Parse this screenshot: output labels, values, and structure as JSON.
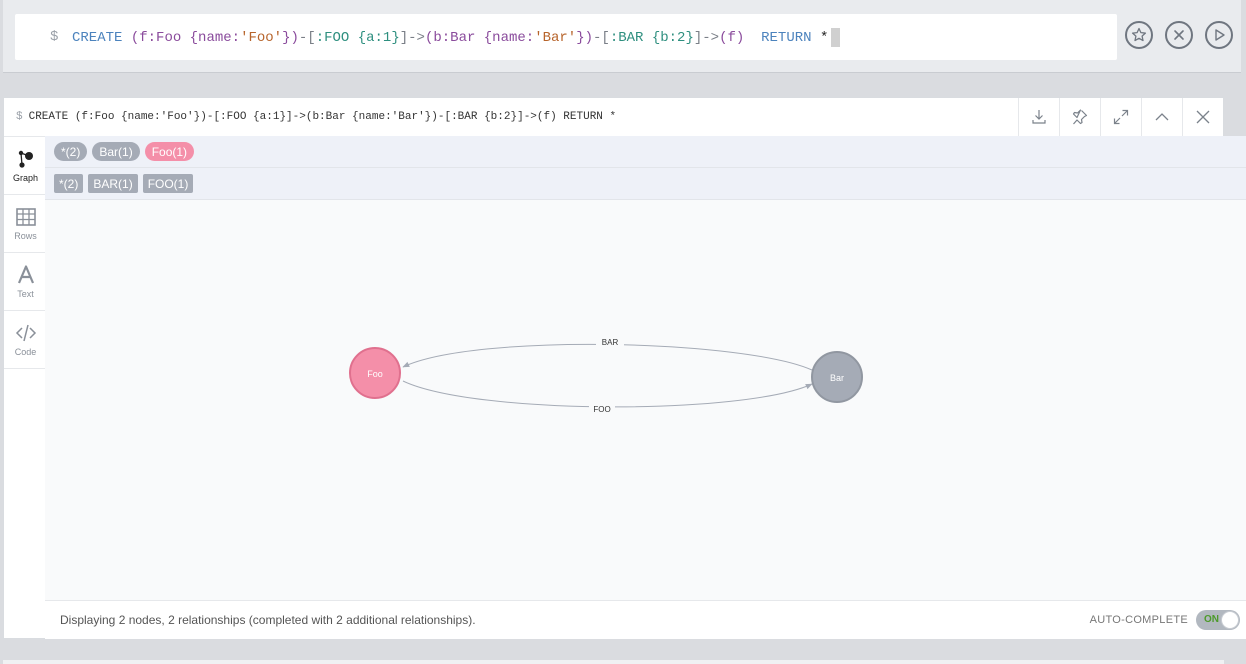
{
  "editor": {
    "prompt": "$",
    "tokens": {
      "create": "CREATE",
      "n1_open": "(",
      "n1_var": "f:Foo",
      "n1_brace_open": " {name:",
      "n1_val": "'Foo'",
      "n1_close": "})",
      "rel1_open": "-[",
      "rel1_type": ":FOO",
      "rel1_props": " {a:1}",
      "rel1_close": "]->",
      "n2_open": "(",
      "n2_var": "b:Bar",
      "n2_brace_open": " {name:",
      "n2_val": "'Bar'",
      "n2_close": "})",
      "rel2_open": "-[",
      "rel2_type": ":BAR",
      "rel2_props": " {b:2}",
      "rel2_close": "]->",
      "n3": "(f)",
      "return": "RETURN",
      "star": "*"
    },
    "actions": {
      "favorite": "star-icon",
      "clear": "close-icon",
      "run": "play-icon"
    }
  },
  "frame": {
    "title_prompt": "$",
    "title": "CREATE (f:Foo {name:'Foo'})-[:FOO {a:1}]->(b:Bar {name:'Bar'})-[:BAR {b:2}]->(f) RETURN *",
    "sidebar": [
      {
        "label": "Graph",
        "icon": "graph-icon"
      },
      {
        "label": "Rows",
        "icon": "table-icon"
      },
      {
        "label": "Text",
        "icon": "text-icon"
      },
      {
        "label": "Code",
        "icon": "code-icon"
      }
    ],
    "node_labels": [
      {
        "text": "*(2)",
        "color": "#a5abb6"
      },
      {
        "text": "Bar(1)",
        "color": "#a5abb6"
      },
      {
        "text": "Foo(1)",
        "color": "#f48fa9"
      }
    ],
    "rel_types": [
      {
        "text": "*(2)"
      },
      {
        "text": "BAR(1)"
      },
      {
        "text": "FOO(1)"
      }
    ],
    "graph": {
      "nodes": [
        {
          "id": "foo",
          "caption": "Foo",
          "color": "#f48fa9",
          "stroke": "#e0708e"
        },
        {
          "id": "bar",
          "caption": "Bar",
          "color": "#a5abb6",
          "stroke": "#9197a1"
        }
      ],
      "relationships": [
        {
          "type": "BAR",
          "from": "bar",
          "to": "foo"
        },
        {
          "type": "FOO",
          "from": "foo",
          "to": "bar"
        }
      ]
    },
    "status": "Displaying 2 nodes, 2 relationships (completed with 2 additional relationships).",
    "autocomplete_label": "AUTO-COMPLETE",
    "autocomplete_state": "ON"
  }
}
